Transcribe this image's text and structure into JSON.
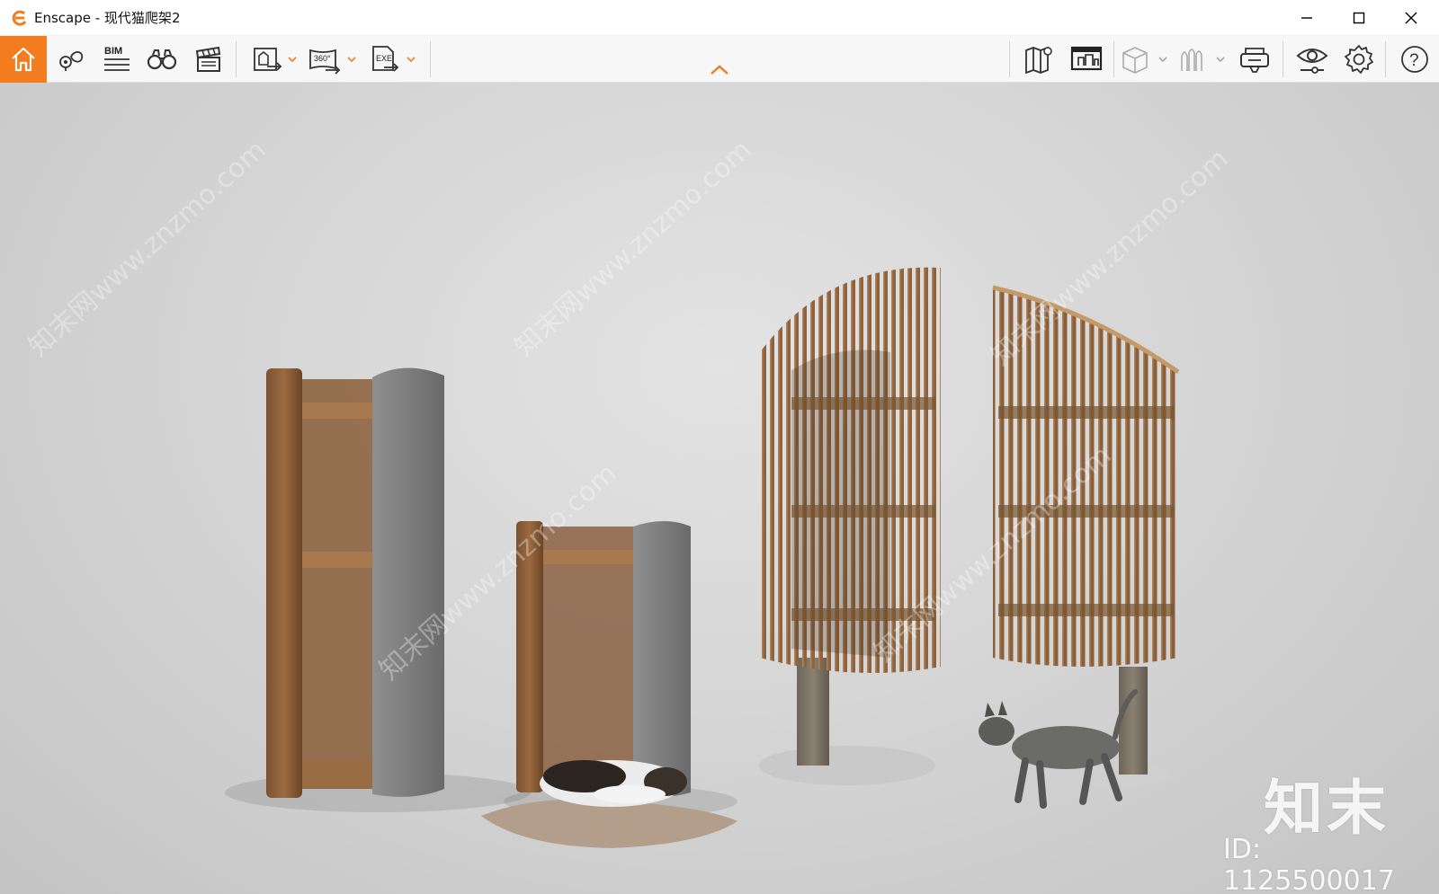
{
  "window": {
    "title": "Enscape - 现代猫爬架2",
    "controls": [
      "minimize",
      "maximize",
      "close"
    ]
  },
  "toolbar": {
    "accent_color": "#f27c1e",
    "left_tools": [
      {
        "name": "home-icon",
        "active": true
      },
      {
        "name": "views-pin-icon"
      },
      {
        "name": "bim-icon",
        "label": "BIM"
      },
      {
        "name": "binoculars-icon"
      },
      {
        "name": "clapperboard-icon"
      },
      {
        "name": "render-export-icon",
        "has_dropdown": true
      },
      {
        "name": "panorama-360-icon",
        "label": "360°",
        "has_dropdown": true
      },
      {
        "name": "exe-export-icon",
        "label": "EXE",
        "has_dropdown": true
      }
    ],
    "right_tools": [
      {
        "name": "map-icon"
      },
      {
        "name": "batch-render-icon"
      },
      {
        "name": "asset-box-icon",
        "has_dropdown": true
      },
      {
        "name": "atmosphere-icon",
        "has_dropdown": true
      },
      {
        "name": "vr-headset-icon"
      },
      {
        "name": "visual-settings-eye-icon"
      },
      {
        "name": "settings-gear-icon"
      },
      {
        "name": "help-icon",
        "label": "?"
      }
    ]
  },
  "viewport": {
    "watermark_site": "知末网www.znzmo.com",
    "watermark_brand": "知末",
    "watermark_id": "ID: 1125500017"
  }
}
